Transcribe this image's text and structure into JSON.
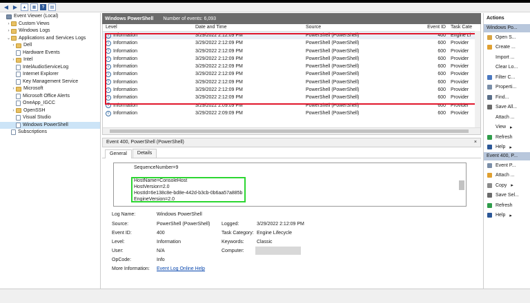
{
  "toolbar": {
    "help_label": "?"
  },
  "tree": {
    "items": [
      {
        "label": "Event Viewer (Local)",
        "indent": 0,
        "arrow": "",
        "icon": "ev"
      },
      {
        "label": "Custom Views",
        "indent": 1,
        "arrow": "›",
        "icon": "folder"
      },
      {
        "label": "Windows Logs",
        "indent": 1,
        "arrow": "›",
        "icon": "folder"
      },
      {
        "label": "Applications and Services Logs",
        "indent": 1,
        "arrow": "⌄",
        "icon": "folder"
      },
      {
        "label": "Dell",
        "indent": 2,
        "arrow": "›",
        "icon": "folder"
      },
      {
        "label": "Hardware Events",
        "indent": 2,
        "arrow": "",
        "icon": "log"
      },
      {
        "label": "Intel",
        "indent": 2,
        "arrow": "›",
        "icon": "folder"
      },
      {
        "label": "IntelAudioServiceLog",
        "indent": 2,
        "arrow": "",
        "icon": "log"
      },
      {
        "label": "Internet Explorer",
        "indent": 2,
        "arrow": "",
        "icon": "log"
      },
      {
        "label": "Key Management Service",
        "indent": 2,
        "arrow": "",
        "icon": "log"
      },
      {
        "label": "Microsoft",
        "indent": 2,
        "arrow": "›",
        "icon": "folder"
      },
      {
        "label": "Microsoft Office Alerts",
        "indent": 2,
        "arrow": "",
        "icon": "log"
      },
      {
        "label": "OneApp_IGCC",
        "indent": 2,
        "arrow": "",
        "icon": "log"
      },
      {
        "label": "OpenSSH",
        "indent": 2,
        "arrow": "›",
        "icon": "folder"
      },
      {
        "label": "Visual Studio",
        "indent": 2,
        "arrow": "",
        "icon": "log"
      },
      {
        "label": "Windows PowerShell",
        "indent": 2,
        "arrow": "",
        "icon": "log",
        "selected": true
      },
      {
        "label": "Subscriptions",
        "indent": 1,
        "arrow": "",
        "icon": "log"
      }
    ]
  },
  "log": {
    "title": "Windows PowerShell",
    "count_text": "Number of events: 6,093"
  },
  "grid": {
    "headers": [
      "Level",
      "Date and Time",
      "Source",
      "Event ID",
      "Task Cate"
    ],
    "rows": [
      [
        "Information",
        "3/29/2022 2:12:09 PM",
        "PowerShell (PowerShell)",
        "400",
        "Engine Li"
      ],
      [
        "Information",
        "3/29/2022 2:12:09 PM",
        "PowerShell (PowerShell)",
        "600",
        "Provider"
      ],
      [
        "Information",
        "3/29/2022 2:12:09 PM",
        "PowerShell (PowerShell)",
        "600",
        "Provider"
      ],
      [
        "Information",
        "3/29/2022 2:12:09 PM",
        "PowerShell (PowerShell)",
        "600",
        "Provider"
      ],
      [
        "Information",
        "3/29/2022 2:12:09 PM",
        "PowerShell (PowerShell)",
        "600",
        "Provider"
      ],
      [
        "Information",
        "3/29/2022 2:12:09 PM",
        "PowerShell (PowerShell)",
        "600",
        "Provider"
      ],
      [
        "Information",
        "3/29/2022 2:12:09 PM",
        "PowerShell (PowerShell)",
        "600",
        "Provider"
      ],
      [
        "Information",
        "3/29/2022 2:12:09 PM",
        "PowerShell (PowerShell)",
        "600",
        "Provider"
      ],
      [
        "Information",
        "3/29/2022 2:12:09 PM",
        "PowerShell (PowerShell)",
        "600",
        "Provider"
      ],
      [
        "Information",
        "3/29/2022 2:09:09 PM",
        "PowerShell (PowerShell)",
        "600",
        "Provider"
      ],
      [
        "Information",
        "3/29/2022 2:09:09 PM",
        "PowerShell (PowerShell)",
        "600",
        "Provider"
      ]
    ]
  },
  "detail": {
    "title": "Event 400, PowerShell (PowerShell)",
    "close": "×",
    "tabs": [
      "General",
      "Details"
    ],
    "xml": {
      "seq": "SequenceNumber=9",
      "host": "HostName=ConsoleHost",
      "version": "HostVersion=2.0",
      "hostid": "HostId=6e138c8e-bd8e-442d-b3cb-0b6aa57a885b",
      "engine": "EngineVersion=2.0"
    },
    "props": {
      "log_name_label": "Log Name:",
      "log_name": "Windows PowerShell",
      "source_label": "Source:",
      "source": "PowerShell (PowerShell)",
      "logged_label": "Logged:",
      "logged": "3/29/2022 2:12:09 PM",
      "event_id_label": "Event ID:",
      "event_id": "400",
      "task_label": "Task Category:",
      "task": "Engine Lifecycle",
      "level_label": "Level:",
      "level": "Information",
      "keywords_label": "Keywords:",
      "keywords": "Classic",
      "user_label": "User:",
      "user": "N/A",
      "computer_label": "Computer:",
      "opcode_label": "OpCode:",
      "opcode": "Info",
      "more_label": "More Information:",
      "more_link": "Event Log Online Help"
    }
  },
  "actions": {
    "title": "Actions",
    "section1": "Windows Po...",
    "items1": [
      {
        "label": "Open S...",
        "color": "#d9a441"
      },
      {
        "label": "Create ...",
        "color": "#e0a030"
      },
      {
        "label": "Import ...",
        "color": "#ffffff"
      },
      {
        "label": "Clear Lo...",
        "color": "#ffffff"
      },
      {
        "label": "Filter C...",
        "color": "#4a78c0"
      },
      {
        "label": "Properti...",
        "color": "#7a8ea8"
      },
      {
        "label": "Find...",
        "color": "#5a6e88"
      },
      {
        "label": "Save All...",
        "color": "#6a6a6a"
      },
      {
        "label": "Attach ...",
        "color": "#ffffff"
      },
      {
        "label": "View",
        "color": "#ffffff",
        "arrow": "▸"
      },
      {
        "label": "Refresh",
        "color": "#2e9c4a"
      },
      {
        "label": "Help",
        "color": "#2b5797",
        "arrow": "▸"
      }
    ],
    "section2": "Event 400, P...",
    "items2": [
      {
        "label": "Event P...",
        "color": "#7a8ea8"
      },
      {
        "label": "Attach ...",
        "color": "#e0a030"
      },
      {
        "label": "Copy",
        "color": "#8a8a8a",
        "arrow": "▸"
      },
      {
        "label": "Save Sel...",
        "color": "#6a6a6a"
      },
      {
        "label": "Refresh",
        "color": "#2e9c4a"
      },
      {
        "label": "Help",
        "color": "#2b5797",
        "arrow": "▸"
      }
    ]
  }
}
